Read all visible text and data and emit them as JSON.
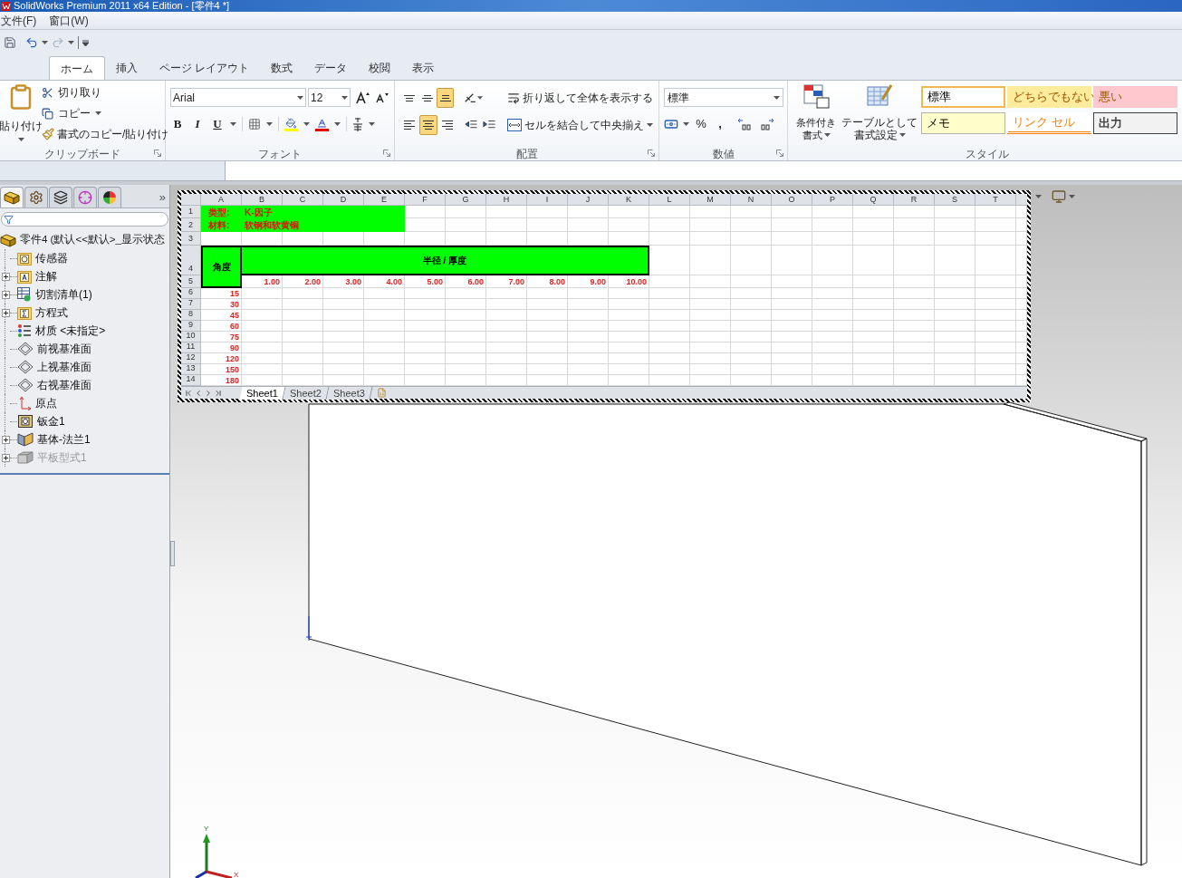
{
  "window": {
    "title": "SolidWorks Premium 2011 x64 Edition - [零件4 *]"
  },
  "menu": [
    "文件(F)",
    "窗口(W)"
  ],
  "ribbon_tabs": [
    {
      "label": "ホーム",
      "selected": true
    },
    {
      "label": "挿入",
      "selected": false
    },
    {
      "label": "ページ レイアウト",
      "selected": false
    },
    {
      "label": "数式",
      "selected": false
    },
    {
      "label": "データ",
      "selected": false
    },
    {
      "label": "校閲",
      "selected": false
    },
    {
      "label": "表示",
      "selected": false
    }
  ],
  "clipboard": {
    "paste": "貼り付け",
    "cut": "切り取り",
    "copy": "コピー",
    "format_painter": "書式のコピー/貼り付け",
    "label": "クリップボード"
  },
  "font": {
    "name": "Arial",
    "size": "12",
    "format_buttons": [
      "B",
      "I",
      "U"
    ],
    "label": "フォント"
  },
  "alignment": {
    "vertical": [
      {
        "kind": "top",
        "selected": false
      },
      {
        "kind": "middle",
        "selected": false
      },
      {
        "kind": "bottom",
        "selected": true
      }
    ],
    "horizontal": [
      {
        "kind": "left",
        "selected": false
      },
      {
        "kind": "center",
        "selected": true
      },
      {
        "kind": "right",
        "selected": false
      }
    ],
    "wrap_text": "折り返して全体を表示する",
    "merge_center": "セルを結合して中央揃え",
    "label": "配置"
  },
  "number": {
    "format": "標準",
    "percent": "%",
    "comma": ",",
    "label": "数値"
  },
  "styles": {
    "conditional": [
      "条件付き",
      "書式"
    ],
    "as_table": [
      "テーブルとして",
      "書式設定"
    ],
    "cells": [
      {
        "label": "標準",
        "kind": "normal",
        "color": "#ffffff",
        "selected": true
      },
      {
        "label": "どちらでもない",
        "kind": "fill",
        "color": "#ffeb9c",
        "selected": false
      },
      {
        "label": "悪い",
        "kind": "fill",
        "color": "#ffc7ce",
        "selected": false
      },
      {
        "label": "メモ",
        "kind": "note",
        "color": "#ffffcc",
        "selected": false
      },
      {
        "label": "リンク セル",
        "kind": "link",
        "color": "#fa7d00",
        "selected": false
      },
      {
        "label": "出力",
        "kind": "output",
        "color": "#f2f2f2",
        "selected": false
      }
    ],
    "label": "スタイル"
  },
  "panel_tabs": [
    {
      "kind": "features",
      "selected": true
    },
    {
      "kind": "properties",
      "selected": false
    },
    {
      "kind": "configurations",
      "selected": false
    },
    {
      "kind": "dimxpert",
      "selected": false
    },
    {
      "kind": "display",
      "selected": false
    }
  ],
  "panel_more": "»",
  "feature_tree": {
    "label": "零件4 (默认<<默认>_显示状态",
    "children": [
      {
        "label": "传感器",
        "kind": "sensor",
        "expandable": false,
        "disabled": false
      },
      {
        "label": "注解",
        "kind": "annotation",
        "expandable": true,
        "disabled": false
      },
      {
        "label": "切割清单(1)",
        "kind": "cutlist",
        "expandable": true,
        "disabled": false
      },
      {
        "label": "方程式",
        "kind": "equation",
        "expandable": true,
        "disabled": false
      },
      {
        "label": "材质 <未指定>",
        "kind": "material",
        "expandable": false,
        "disabled": false
      },
      {
        "label": "前视基准面",
        "kind": "plane",
        "expandable": false,
        "disabled": false
      },
      {
        "label": "上视基准面",
        "kind": "plane",
        "expandable": false,
        "disabled": false
      },
      {
        "label": "右视基准面",
        "kind": "plane",
        "expandable": false,
        "disabled": false
      },
      {
        "label": "原点",
        "kind": "origin",
        "expandable": false,
        "disabled": false
      },
      {
        "label": "钣金1",
        "kind": "sheetmetal",
        "expandable": false,
        "disabled": false
      },
      {
        "label": "基体-法兰1",
        "kind": "flange",
        "expandable": true,
        "disabled": false
      },
      {
        "label": "平板型式1",
        "kind": "flat",
        "expandable": true,
        "disabled": true
      }
    ]
  },
  "spreadsheet": {
    "columns": [
      "A",
      "B",
      "C",
      "D",
      "E",
      "F",
      "G",
      "H",
      "I",
      "J",
      "K",
      "L",
      "M",
      "N",
      "O",
      "P",
      "Q",
      "R",
      "S",
      "T"
    ],
    "row_numbers": [
      "1",
      "2",
      "3",
      "4",
      "5",
      "6",
      "7",
      "8",
      "9",
      "10",
      "11",
      "12",
      "13",
      "14"
    ],
    "info": [
      {
        "label": "类型:",
        "value": "K-因子"
      },
      {
        "label": "材料:",
        "value": "软钢和软黄铜"
      }
    ],
    "angle_header": "角度",
    "ratio_header": "半径 / 厚度",
    "ratios": [
      "1.00",
      "2.00",
      "3.00",
      "4.00",
      "5.00",
      "6.00",
      "7.00",
      "8.00",
      "9.00",
      "10.00"
    ],
    "angles": [
      "15",
      "30",
      "45",
      "60",
      "75",
      "90",
      "120",
      "150",
      "180"
    ],
    "sheet_tabs": [
      {
        "label": "Sheet1",
        "selected": true
      },
      {
        "label": "Sheet2",
        "selected": false
      },
      {
        "label": "Sheet3",
        "selected": false
      }
    ]
  },
  "triad_labels": [
    "Y",
    "X"
  ]
}
